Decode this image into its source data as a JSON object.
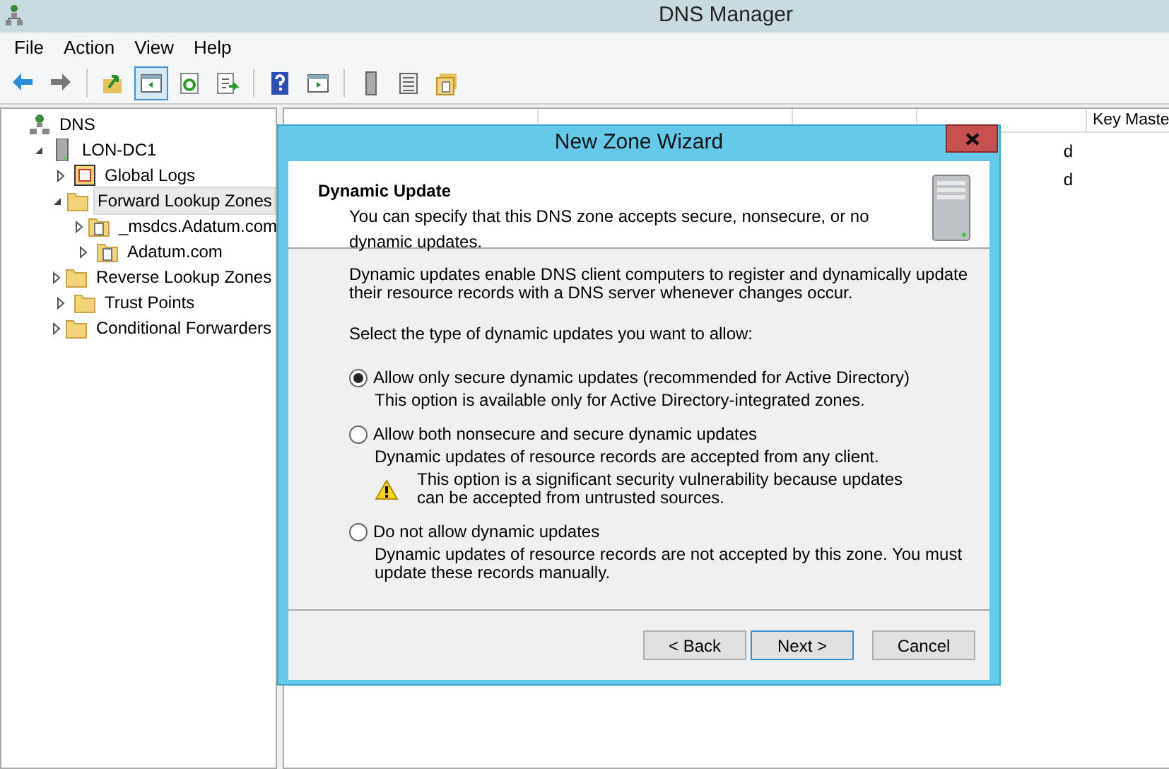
{
  "window": {
    "title": "DNS Manager"
  },
  "menu": [
    "File",
    "Action",
    "View",
    "Help"
  ],
  "toolbar": [
    {
      "kind": "back",
      "pressed": false
    },
    {
      "kind": "forward",
      "pressed": false
    },
    {
      "kind": "up",
      "pressed": false
    },
    {
      "kind": "tree",
      "pressed": true
    },
    {
      "kind": "refresh",
      "pressed": false
    },
    {
      "kind": "export",
      "pressed": false
    },
    {
      "kind": "help",
      "pressed": false
    },
    {
      "kind": "pane",
      "pressed": false
    },
    {
      "kind": "server",
      "pressed": false
    },
    {
      "kind": "list",
      "pressed": false
    },
    {
      "kind": "folders",
      "pressed": false
    }
  ],
  "tree": [
    {
      "label": "DNS",
      "kind": "root",
      "selected": false,
      "children": [
        {
          "label": "LON-DC1",
          "kind": "server",
          "selected": false,
          "expanded": true,
          "children": [
            {
              "label": "Global Logs",
              "kind": "logs",
              "selected": false,
              "expanded": false
            },
            {
              "label": "Forward Lookup Zones",
              "kind": "folder",
              "selected": true,
              "expanded": true,
              "children": [
                {
                  "label": "_msdcs.Adatum.com",
                  "kind": "zone",
                  "selected": false,
                  "expanded": false
                },
                {
                  "label": "Adatum.com",
                  "kind": "zone",
                  "selected": false,
                  "expanded": false
                }
              ]
            },
            {
              "label": "Reverse Lookup Zones",
              "kind": "folder",
              "selected": false,
              "expanded": false
            },
            {
              "label": "Trust Points",
              "kind": "folder",
              "selected": false,
              "expanded": false
            },
            {
              "label": "Conditional Forwarders",
              "kind": "folder",
              "selected": false,
              "expanded": false
            }
          ]
        }
      ]
    }
  ],
  "table": {
    "columns": [
      "Key Maste"
    ],
    "rows": [
      {
        "column_4": "d"
      },
      {
        "column_4": "d"
      }
    ]
  },
  "dialog": {
    "title": "New Zone Wizard",
    "heading": "Dynamic Update",
    "subtitle": "You can specify that this DNS zone accepts secure, nonsecure, or no dynamic updates.",
    "intro": "Dynamic updates enable DNS client computers to register and dynamically update their resource records with a DNS server whenever changes occur.",
    "prompt": "Select the type of dynamic updates you want to allow:",
    "options": [
      {
        "label": "Allow only secure dynamic updates (recommended for Active Directory)",
        "description": "This option is available only for Active Directory-integrated zones.",
        "selected": true
      },
      {
        "label": "Allow both nonsecure and secure dynamic updates",
        "description": "Dynamic updates of resource records are accepted from any client.",
        "warning": "This option is a significant security vulnerability because updates can be accepted from untrusted sources.",
        "selected": false
      },
      {
        "label": "Do not allow dynamic updates",
        "description": "Dynamic updates of resource records are not accepted by this zone. You must update these records manually.",
        "selected": false
      }
    ],
    "buttons": [
      {
        "label": "< Back",
        "default": false
      },
      {
        "label": "Next >",
        "default": true
      },
      {
        "label": "Cancel",
        "default": false
      }
    ]
  }
}
